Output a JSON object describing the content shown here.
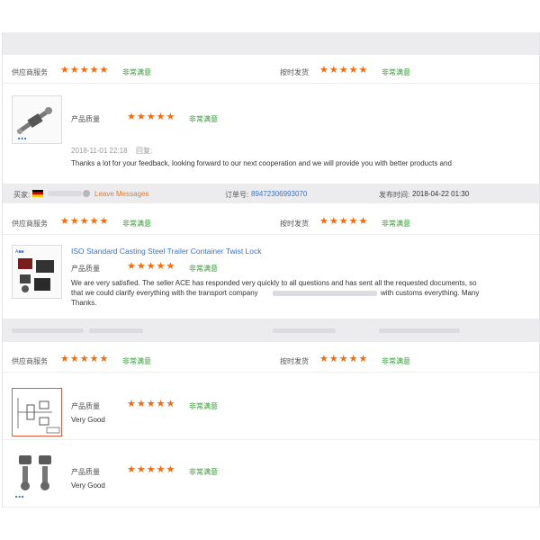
{
  "colors": {
    "star": "#f26b10",
    "satisfied": "#2d9a2d",
    "link": "#3a72c4",
    "header_bg": "#ececee"
  },
  "review1": {
    "supplier_service": {
      "label": "供应商服务",
      "stars": "★★★★★",
      "rating": "非常满意"
    },
    "on_time_delivery": {
      "label": "按时发货",
      "stars": "★★★★★",
      "rating": "非常满意"
    },
    "product_quality": {
      "label": "产品质量",
      "stars": "★★★★★",
      "rating": "非常满意"
    },
    "date": "2018-11-01 22:18",
    "reply_label": "回复:",
    "reply_text": "Thanks a lot for your feedback, looking forward to our next cooperation and we will provide you with better products and"
  },
  "order_bar": {
    "buyer_label": "买家:",
    "leave_messages": "Leave Messages",
    "order_no_label": "订单号:",
    "order_no": "89472306993070",
    "published_label": "发布时间:",
    "published": "2018-04-22 01:30"
  },
  "review2": {
    "supplier_service": {
      "label": "供应商服务",
      "stars": "★★★★★",
      "rating": "非常满意"
    },
    "on_time_delivery": {
      "label": "按时发货",
      "stars": "★★★★★",
      "rating": "非常满意"
    },
    "product_title": "ISO Standard Casting Steel Trailer Container Twist Lock",
    "product_quality": {
      "label": "产品质量",
      "stars": "★★★★★",
      "rating": "非常满意"
    },
    "comment_line1": "We are very satisfied. The seller ACE has responded very quickly to all questions and has sent all the requested documents, so",
    "comment_line2a": "that we could clarify everything with the transport company",
    "comment_line2b": "with customs everything. Many",
    "comment_line3": "Thanks."
  },
  "review3": {
    "supplier_service": {
      "label": "供应商服务",
      "stars": "★★★★★",
      "rating": "非常满意"
    },
    "on_time_delivery": {
      "label": "按时发货",
      "stars": "★★★★★",
      "rating": "非常满意"
    },
    "item1": {
      "label": "产品质量",
      "stars": "★★★★★",
      "rating": "非常满意",
      "comment": "Very Good"
    },
    "item2": {
      "label": "产品质量",
      "stars": "★★★★★",
      "rating": "非常满意",
      "comment": "Very Good"
    }
  }
}
